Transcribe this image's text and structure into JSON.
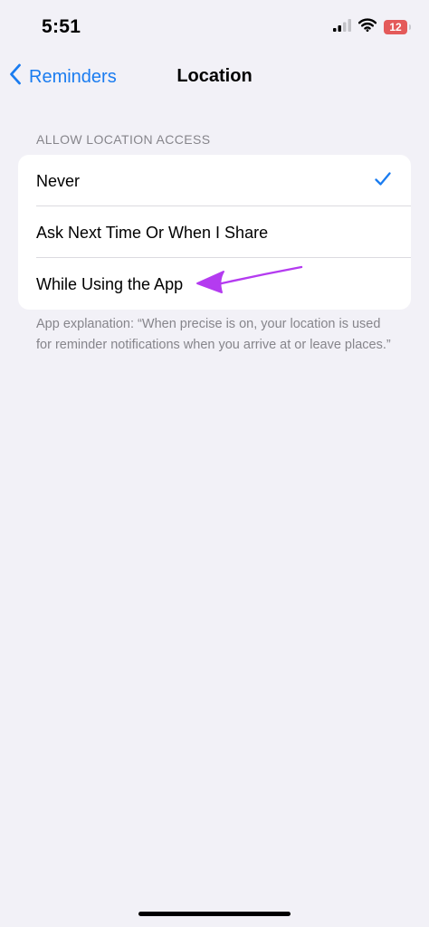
{
  "status_bar": {
    "time": "5:51",
    "battery_level": "12",
    "icons": [
      "cellular-signal-icon",
      "wifi-icon",
      "battery-icon"
    ],
    "battery_color": "#e45a5a"
  },
  "nav": {
    "back_label": "Reminders",
    "title": "Location",
    "accent_color": "#1a7cf0"
  },
  "section": {
    "header": "ALLOW LOCATION ACCESS",
    "options": [
      {
        "label": "Never",
        "selected": true
      },
      {
        "label": "Ask Next Time Or When I Share",
        "selected": false
      },
      {
        "label": "While Using the App",
        "selected": false
      }
    ],
    "footer": "App explanation: “When precise is on, your location is used for reminder notifications when you arrive at or leave places.”"
  },
  "annotation": {
    "icon": "arrow-icon",
    "color": "#b43bf0"
  }
}
